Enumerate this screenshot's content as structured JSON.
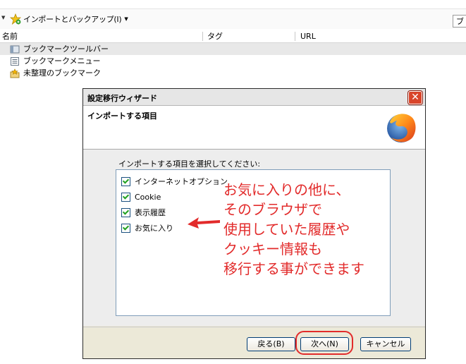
{
  "toolbar": {
    "import_backup_label": "インポートとバックアップ(I)",
    "search_partial": "ブ"
  },
  "columns": {
    "name": "名前",
    "tags": "タグ",
    "url": "URL"
  },
  "tree": {
    "items": [
      {
        "label": "ブックマークツールバー"
      },
      {
        "label": "ブックマークメニュー"
      },
      {
        "label": "未整理のブックマーク"
      }
    ]
  },
  "dialog": {
    "title": "設定移行ウィザード",
    "header": "インポートする項目",
    "instruction": "インポートする項目を選択してください:",
    "options": [
      {
        "label": "インターネットオプション",
        "checked": true
      },
      {
        "label": "Cookie",
        "checked": true
      },
      {
        "label": "表示履歴",
        "checked": true
      },
      {
        "label": "お気に入り",
        "checked": true
      }
    ],
    "buttons": {
      "back": "戻る(B)",
      "next": "次へ(N)",
      "cancel": "キャンセル"
    }
  },
  "annotation": {
    "text": "お気に入りの他に、\nそのブラウザで\n使用していた履歴や\nクッキー情報も\n移行する事ができます",
    "color": "#e22b2b"
  }
}
